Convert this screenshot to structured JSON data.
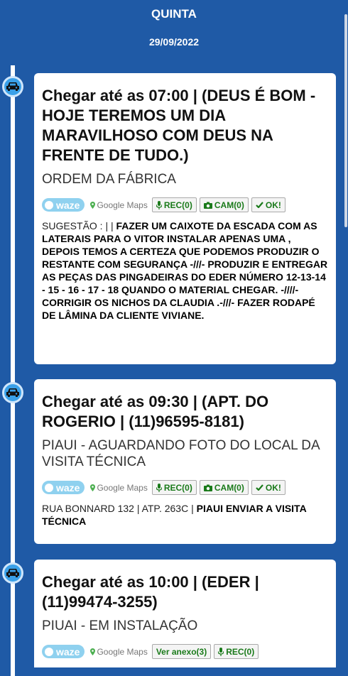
{
  "header": {
    "day": "QUINTA",
    "date": "29/09/2022"
  },
  "entries": [
    {
      "title": "Chegar até as 07:00 | (DEUS É BOM - HOJE TEREMOS UM DIA MARAVILHOSO COM DEUS NA FRENTE DE TUDO.)",
      "subtitle": "ORDEM DA FÁBRICA",
      "waze": "waze",
      "gmaps": "Google Maps",
      "rec": "REC(0)",
      "cam": "CAM(0)",
      "ok": "OK!",
      "note_prefix": "SUGESTÃO : | | ",
      "note_bold": "FAZER UM CAIXOTE DA ESCADA COM AS LATERAIS PARA O VITOR INSTALAR APENAS UMA , DEPOIS TEMOS A CERTEZA QUE PODEMOS PRODUZIR O RESTANTE COM SEGURANÇA -///- PRODUZIR E ENTREGAR AS PEÇAS DAS PINGADEIRAS DO EDER NÚMERO 12-13-14 - 15 - 16 - 17 - 18 QUANDO O MATERIAL CHEGAR. -////- CORRIGIR OS NICHOS DA CLAUDIA .-///- FAZER RODAPÉ DE LÂMINA DA CLIENTE VIVIANE."
    },
    {
      "title": "Chegar até as 09:30 | (APT. DO ROGERIO | (11)96595-8181)",
      "subtitle": "PIAUI - AGUARDANDO FOTO DO LOCAL DA VISITA TÉCNICA",
      "waze": "waze",
      "gmaps": "Google Maps",
      "rec": "REC(0)",
      "cam": "CAM(0)",
      "ok": "OK!",
      "note_prefix": "RUA BONNARD 132 | ATP. 263C | ",
      "note_bold": "PIAUI ENVIAR A VISITA TÉCNICA"
    },
    {
      "title": "Chegar até as 10:00 | (EDER | (11)99474-3255)",
      "subtitle": "PIUAI - EM INSTALAÇÃO",
      "waze": "waze",
      "gmaps": "Google Maps",
      "anexo": "Ver anexo(3)",
      "rec": "REC(0)"
    }
  ],
  "colors": {
    "background": "#1f5aa6",
    "car_badge": "#3aa0e8",
    "button_text": "#1a7a1a",
    "waze": "#8fd1ef"
  },
  "icons": [
    "car-icon",
    "waze-icon",
    "map-pin-icon",
    "microphone-icon",
    "camera-icon",
    "check-icon"
  ]
}
